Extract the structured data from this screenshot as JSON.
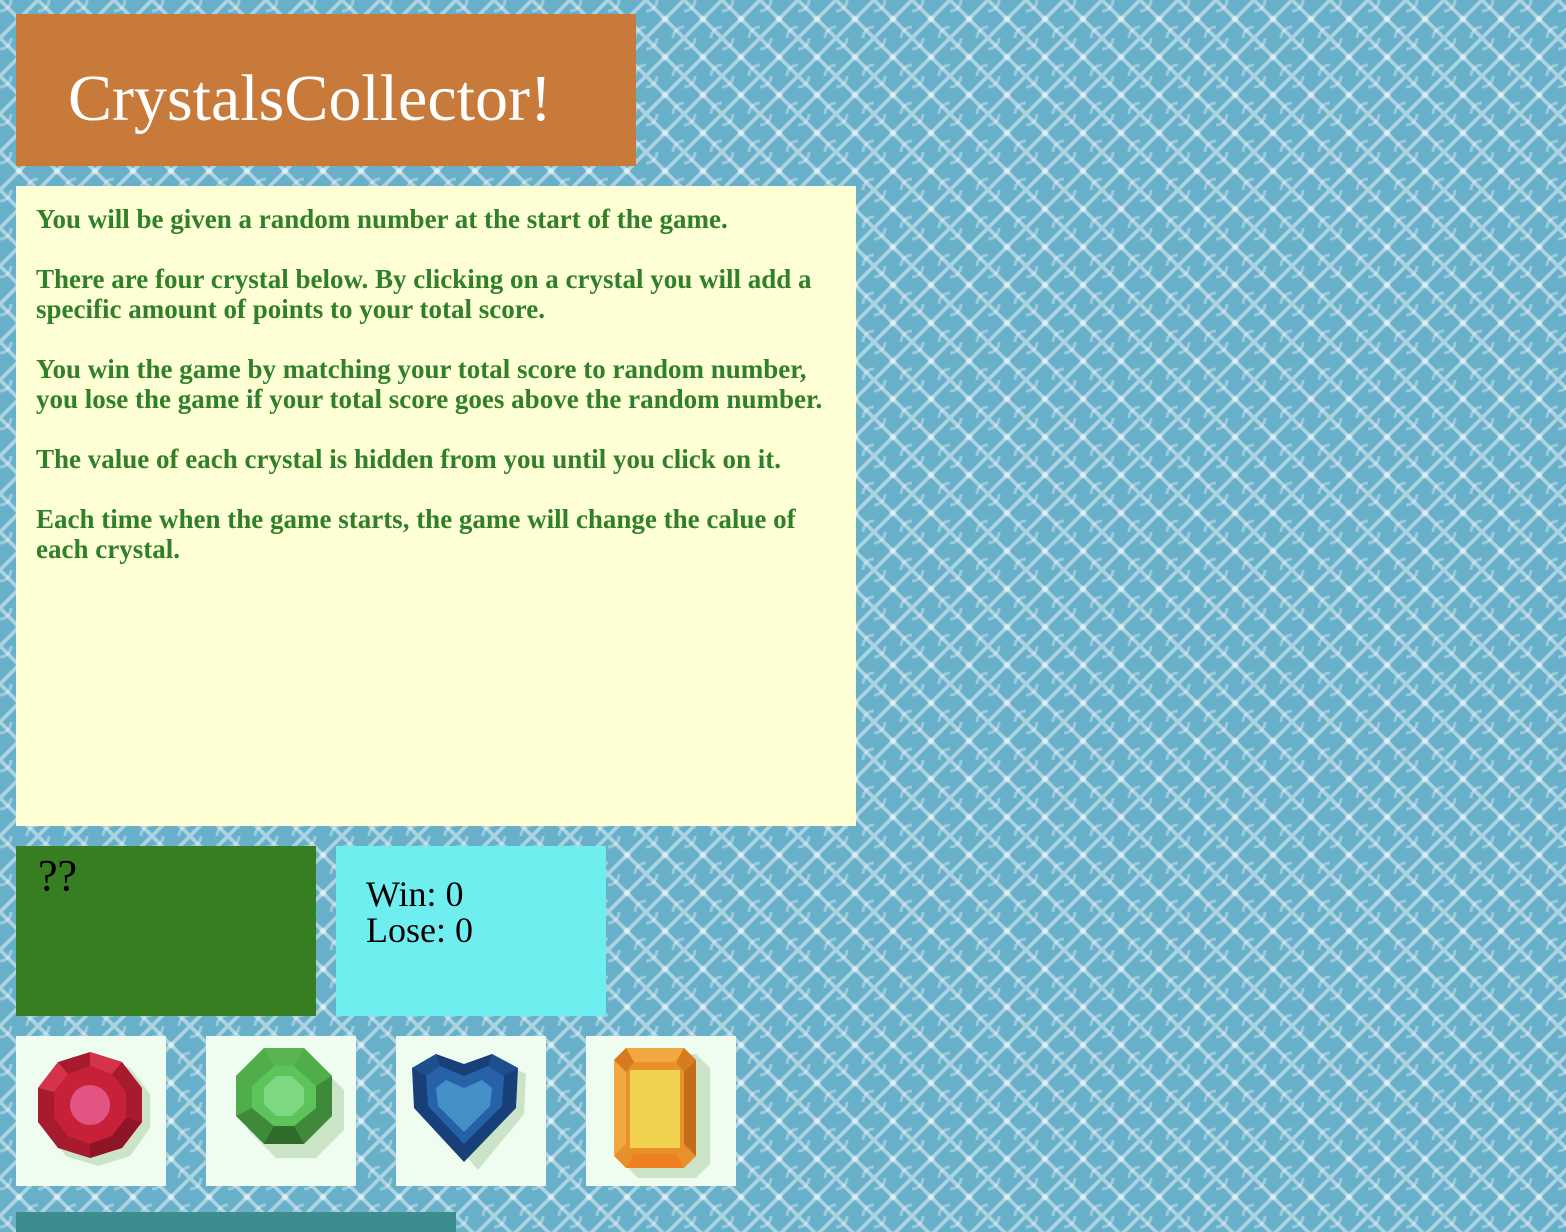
{
  "header": {
    "title": "CrystalsCollector!"
  },
  "instructions": {
    "paragraphs": [
      "You will be given a random number at the start of the game.",
      "There are four crystal below. By clicking on a crystal you will add a specific amount of points to your total score.",
      "You win the game by matching your total score to random number, you lose the game if your total score goes above the random number.",
      "The value of each crystal is hidden from you until you click on it.",
      "Each time when the game starts, the game will change the calue of each crystal."
    ]
  },
  "target": {
    "value": "??"
  },
  "scoreboard": {
    "win_text": "Win: 0",
    "lose_text": "Lose: 0"
  },
  "crystals": [
    {
      "icon": "red-gem-icon",
      "color": "#c7213a"
    },
    {
      "icon": "green-gem-icon",
      "color": "#4fae49"
    },
    {
      "icon": "blue-heart-gem-icon",
      "color": "#1d4f8f"
    },
    {
      "icon": "orange-gem-icon",
      "color": "#e8912b"
    }
  ],
  "colors": {
    "title_bg": "#c87a3a",
    "instructions_bg": "#ffffd6",
    "instructions_text": "#2f8029",
    "target_bg": "#367e21",
    "score_bg": "#6feef0",
    "crystal_bg": "#eefdf0",
    "page_bg": "#68afc9"
  }
}
